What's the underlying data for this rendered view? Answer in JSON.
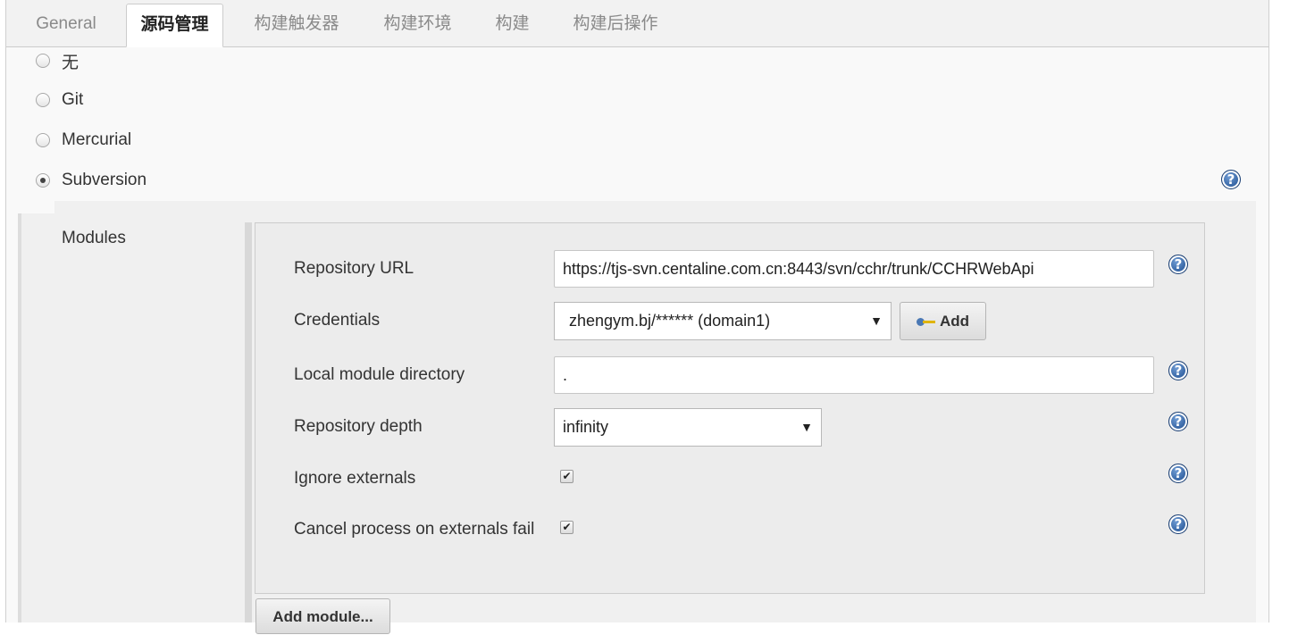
{
  "tabs": [
    {
      "label": "General",
      "active": false
    },
    {
      "label": "源码管理",
      "active": true
    },
    {
      "label": "构建触发器",
      "active": false
    },
    {
      "label": "构建环境",
      "active": false
    },
    {
      "label": "构建",
      "active": false
    },
    {
      "label": "构建后操作",
      "active": false
    }
  ],
  "scm_options": [
    {
      "label": "无",
      "checked": false
    },
    {
      "label": "Git",
      "checked": false
    },
    {
      "label": "Mercurial",
      "checked": false
    },
    {
      "label": "Subversion",
      "checked": true
    }
  ],
  "help_icon": "question-mark-icon",
  "modules": {
    "label": "Modules",
    "repository_url": {
      "label": "Repository URL",
      "value": "https://tjs-svn.centaline.com.cn:8443/svn/cchr/trunk/CCHRWebApi"
    },
    "credentials": {
      "label": "Credentials",
      "selected": "zhengym.bj/****** (domain1)",
      "add_label": "Add",
      "add_icon": "key-icon"
    },
    "local_module_directory": {
      "label": "Local module directory",
      "value": "."
    },
    "repository_depth": {
      "label": "Repository depth",
      "selected": "infinity"
    },
    "ignore_externals": {
      "label": "Ignore externals",
      "checked": true
    },
    "cancel_process_on_externals_fail": {
      "label": "Cancel process on externals fail",
      "checked": true
    },
    "add_module_label": "Add module..."
  },
  "colors": {
    "panel_bg": "#f9f9f9",
    "module_bg": "#ececec",
    "help_blue": "#2f5e9e"
  }
}
